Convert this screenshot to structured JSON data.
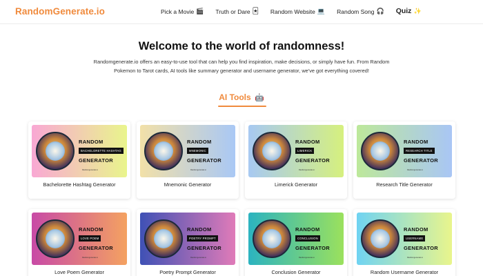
{
  "brand": "RandomGenerate.io",
  "nav": [
    {
      "label": "Pick a Movie",
      "emoji": "🎬"
    },
    {
      "label": "Truth or Dare",
      "emoji": "🃏"
    },
    {
      "label": "Random Website",
      "emoji": "💻"
    },
    {
      "label": "Random Song",
      "emoji": "🎧"
    },
    {
      "label": "Quiz",
      "emoji": "✨"
    }
  ],
  "hero": {
    "title": "Welcome to the world of randomness!",
    "description": "Randomgenerate.io offers an easy-to-use tool that can help you find inspiration, make decisions, or simply have fun. From Random Pokemon to Tarot cards, AI tools like summary generator and username generator, we've got everything covered!"
  },
  "section": {
    "title": "AI Tools",
    "emoji": "🤖"
  },
  "card_text": {
    "random": "RANDOM",
    "generator": "GENERATOR",
    "site": "Randomgenerate.io"
  },
  "cards": [
    {
      "name": "Bachelorette Hashtag Generator",
      "label": "BACHELORETTE HASHTAG",
      "gradient": [
        "#f9a8d4",
        "#e9f58c"
      ]
    },
    {
      "name": "Mnemonic Generator",
      "label": "MNEMONIC",
      "gradient": [
        "#f2e0a8",
        "#a9c8f5"
      ]
    },
    {
      "name": "Limerick Generator",
      "label": "LIMERICK",
      "gradient": [
        "#a7c9f2",
        "#d6f07e"
      ]
    },
    {
      "name": "Research Title Generator",
      "label": "RESEARCH TITLE",
      "gradient": [
        "#bde89a",
        "#a9c6f5"
      ]
    },
    {
      "name": "Love Poem Generator",
      "label": "LOVE POEM",
      "gradient": [
        "#c84aa6",
        "#f4a261"
      ]
    },
    {
      "name": "Poetry Prompt Generator",
      "label": "POETRY PROMPT",
      "gradient": [
        "#3f51b5",
        "#e07bb8"
      ]
    },
    {
      "name": "Conclusion Generator",
      "label": "CONCLUSION",
      "gradient": [
        "#2bb3c0",
        "#9be15d"
      ]
    },
    {
      "name": "Random Username Generator",
      "label": "USERNAME",
      "gradient": [
        "#6fd3f2",
        "#e9f58c"
      ]
    }
  ]
}
